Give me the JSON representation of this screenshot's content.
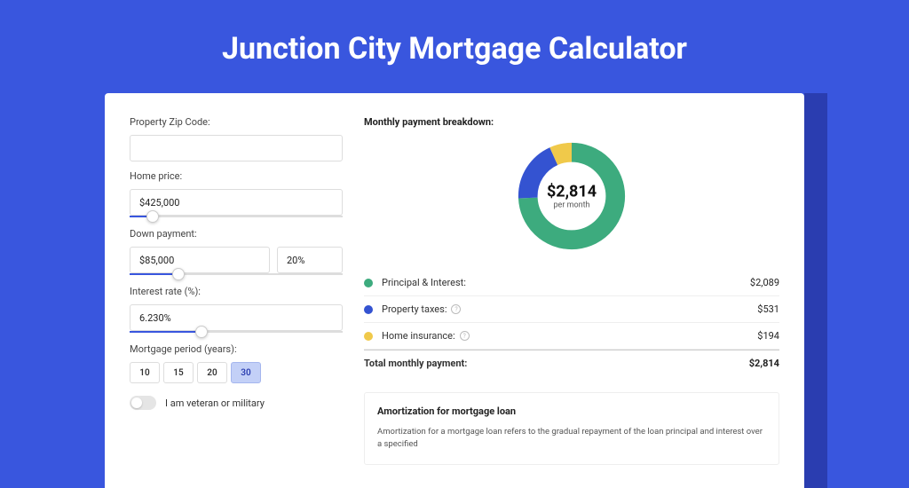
{
  "title": "Junction City Mortgage Calculator",
  "fields": {
    "zip": {
      "label": "Property Zip Code:",
      "value": ""
    },
    "price": {
      "label": "Home price:",
      "value": "$425,000"
    },
    "down": {
      "label": "Down payment:",
      "value": "$85,000",
      "pct": "20%"
    },
    "rate": {
      "label": "Interest rate (%):",
      "value": "6.230%"
    },
    "period": {
      "label": "Mortgage period (years):",
      "options": [
        "10",
        "15",
        "20",
        "30"
      ],
      "active": "30"
    },
    "veteran": {
      "label": "I am veteran or military"
    }
  },
  "breakdown": {
    "title": "Monthly payment breakdown:",
    "donut": {
      "value": "$2,814",
      "sub": "per month"
    },
    "rows": [
      {
        "label": "Principal & Interest:",
        "value": "$2,089",
        "color": "#3dab7e",
        "info": false
      },
      {
        "label": "Property taxes:",
        "value": "$531",
        "color": "#3453d1",
        "info": true
      },
      {
        "label": "Home insurance:",
        "value": "$194",
        "color": "#f0c94a",
        "info": true
      }
    ],
    "total": {
      "label": "Total monthly payment:",
      "value": "$2,814"
    }
  },
  "amort": {
    "title": "Amortization for mortgage loan",
    "text": "Amortization for a mortgage loan refers to the gradual repayment of the loan principal and interest over a specified"
  },
  "chart_data": {
    "type": "pie",
    "title": "Monthly payment breakdown",
    "series": [
      {
        "name": "Principal & Interest",
        "value": 2089,
        "color": "#3dab7e"
      },
      {
        "name": "Property taxes",
        "value": 531,
        "color": "#3453d1"
      },
      {
        "name": "Home insurance",
        "value": 194,
        "color": "#f0c94a"
      }
    ],
    "total": 2814
  }
}
